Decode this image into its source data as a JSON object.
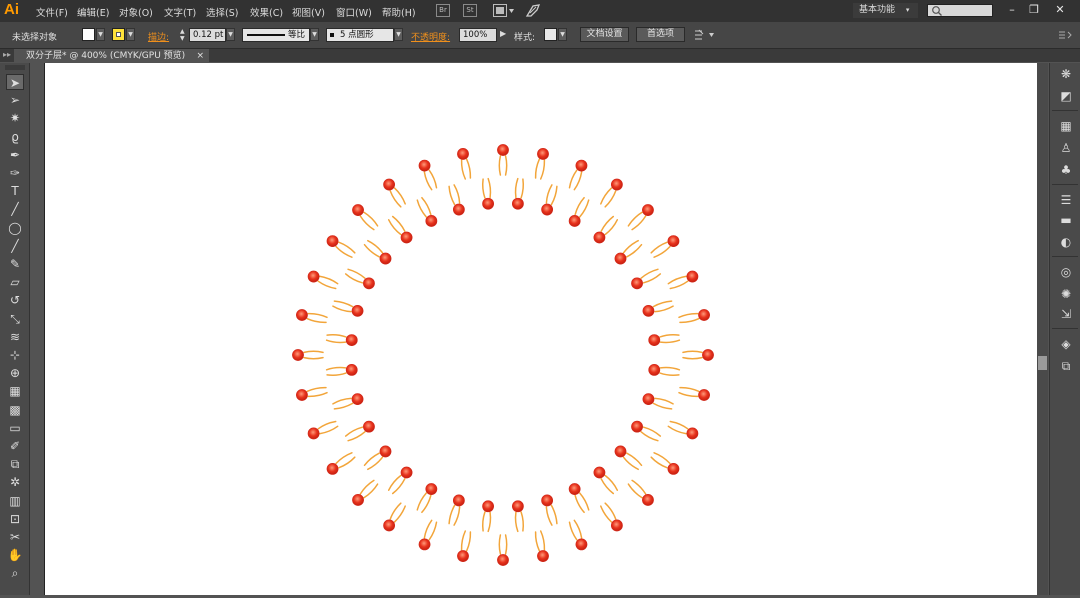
{
  "app": {
    "logo": "Ai"
  },
  "menu": {
    "items": [
      "文件(F)",
      "编辑(E)",
      "对象(O)",
      "文字(T)",
      "选择(S)",
      "效果(C)",
      "视图(V)",
      "窗口(W)",
      "帮助(H)"
    ],
    "bridge_icon": "Br",
    "stock_icon": "St",
    "arrange_icon": "arrange-documents"
  },
  "workspace": {
    "label": "基本功能",
    "arrow": "▾"
  },
  "window_controls": {
    "minimize": "–",
    "restore": "❐",
    "close": "✕"
  },
  "control_bar": {
    "selection_status": "未选择对象",
    "fill_color": "#ffffff",
    "stroke_color": "#ffe23a",
    "stroke_label": "描边",
    "stroke_weight": "0.12 pt",
    "stroke_profile": "等比",
    "brush_definition": "5 点圆形",
    "opacity_label": "不透明度",
    "opacity_value": "100%",
    "style_label": "样式",
    "document_setup": "文档设置",
    "preferences": "首选项",
    "label_color": "#f0901c"
  },
  "document_tab": {
    "title": "双分子层* @ 400% (CMYK/GPU 预览)",
    "close": "×"
  },
  "tools": [
    "selection-tool",
    "direct-selection-tool",
    "magic-wand-tool",
    "lasso-tool",
    "pen-tool",
    "curvature-tool",
    "type-tool",
    "line-tool",
    "ellipse-tool",
    "paintbrush-tool",
    "pencil-tool",
    "eraser-tool",
    "rotate-tool",
    "scale-tool",
    "warp-tool",
    "free-transform-tool",
    "shape-builder-tool",
    "perspective-grid-tool",
    "mesh-tool",
    "gradient-tool",
    "eyedropper-tool",
    "blend-tool",
    "symbol-sprayer-tool",
    "column-graph-tool",
    "artboard-tool",
    "slice-tool",
    "hand-tool",
    "zoom-tool"
  ],
  "dock": [
    "color-guide-icon",
    "color-icon",
    "swatches-icon",
    "brushes-icon",
    "symbols-icon",
    "stroke-icon",
    "gradient-icon",
    "transparency-icon",
    "appearance-icon",
    "graphic-styles-icon",
    "export-icon",
    "layers-icon",
    "artboards-icon"
  ],
  "artwork": {
    "type": "lipid-bilayer-vesicle",
    "outer_head_count": 32,
    "inner_head_count": 32,
    "head_color": "#e8331d",
    "head_highlight": "#ff9a7a",
    "tail_color": "#f2a53a"
  }
}
